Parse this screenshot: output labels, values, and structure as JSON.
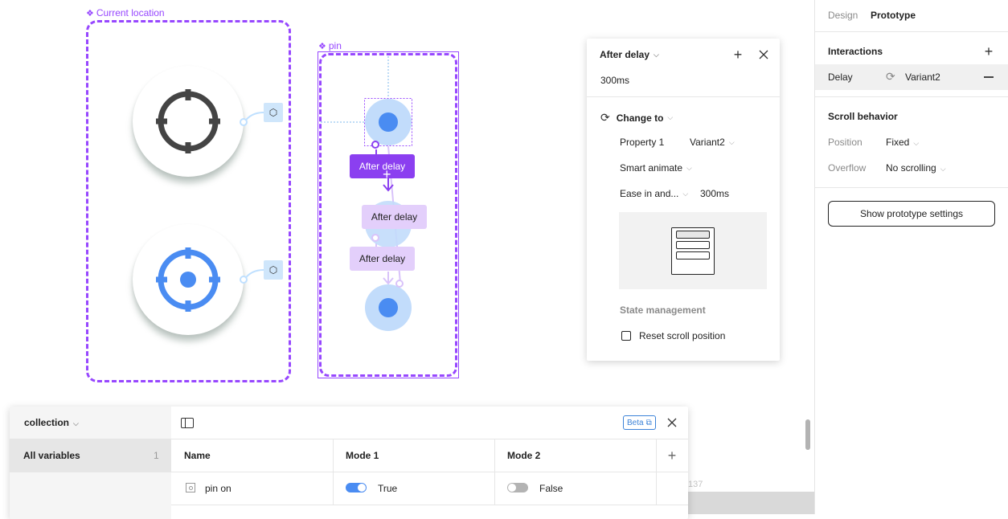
{
  "canvas": {
    "frames": [
      {
        "label": "Current location",
        "icon": "component-icon"
      },
      {
        "label": "pin",
        "icon": "component-icon"
      }
    ],
    "flow_boxes": [
      {
        "label": "After delay",
        "state": "active"
      },
      {
        "label": "After delay",
        "state": "inactive"
      },
      {
        "label": "After delay",
        "state": "inactive"
      }
    ],
    "coordinate_readout": "137",
    "colors": {
      "accent": "#9747ff",
      "flow_active": "#8b3ff0",
      "flow_inactive": "#e3cffb",
      "pin_light": "#c2dcfb",
      "pin_core": "#4a8cf2",
      "crosshair_dark": "#444444",
      "crosshair_blue": "#4a8cf2"
    }
  },
  "interaction_popup": {
    "trigger": "After delay",
    "delay": "300ms",
    "action": "Change to",
    "property_label": "Property 1",
    "property_value": "Variant2",
    "animation": "Smart animate",
    "easing": "Ease in and...",
    "duration": "300ms",
    "state_section": "State management",
    "reset_scroll_label": "Reset scroll position",
    "reset_scroll_checked": false
  },
  "right_panel": {
    "tabs": [
      {
        "label": "Design",
        "active": false
      },
      {
        "label": "Prototype",
        "active": true
      }
    ],
    "interactions_title": "Interactions",
    "interaction": {
      "trigger": "Delay",
      "target": "Variant2"
    },
    "scroll_title": "Scroll behavior",
    "position_label": "Position",
    "position_value": "Fixed",
    "overflow_label": "Overflow",
    "overflow_value": "No scrolling",
    "settings_button": "Show prototype settings"
  },
  "variables": {
    "collection": "collection",
    "groups": [
      {
        "label": "All variables",
        "count": "1"
      }
    ],
    "beta_label": "Beta",
    "columns": [
      "Name",
      "Mode 1",
      "Mode 2"
    ],
    "rows": [
      {
        "name": "pin on",
        "mode1": "True",
        "mode1_on": true,
        "mode2": "False",
        "mode2_on": false
      }
    ]
  }
}
